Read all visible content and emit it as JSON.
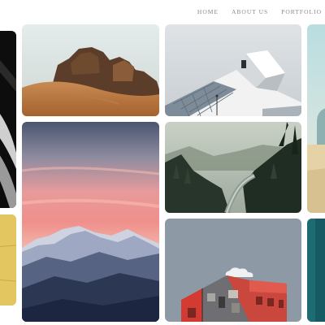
{
  "nav": {
    "items": [
      {
        "label": "HOME"
      },
      {
        "label": "ABOUT US"
      },
      {
        "label": "PORTFOLIO"
      }
    ]
  },
  "gallery": {
    "tiles": [
      {
        "id": "partial-dark-stair",
        "subject": "dark spiral staircase"
      },
      {
        "id": "partial-yellow",
        "subject": "yellow textured wall"
      },
      {
        "id": "desert-rocks",
        "subject": "rock formations in desert dunes"
      },
      {
        "id": "modern-building",
        "subject": "angular modern glass building"
      },
      {
        "id": "partial-arch",
        "subject": "arch on sand"
      },
      {
        "id": "pink-sky-mountains",
        "subject": "pink sunset sky over snowy mountains"
      },
      {
        "id": "forest-river",
        "subject": "misty forest valley with river"
      },
      {
        "id": "red-cube-building",
        "subject": "red and grey block building"
      },
      {
        "id": "partial-teal",
        "subject": "teal wall"
      }
    ]
  },
  "colors": {
    "nav_text": "#8a8a8a",
    "background": "#ffffff"
  }
}
